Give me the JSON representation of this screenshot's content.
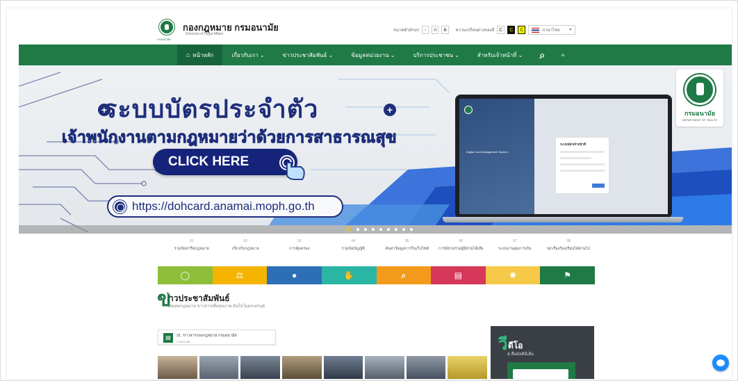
{
  "site": {
    "title": "กองกฎหมาย กรมอนามัย",
    "subtitle": "Divisions of Legal Affairs",
    "logo_caption": "กรมอนามัย"
  },
  "toolbar": {
    "font_size_label": "ขนาดตัวอักษร",
    "font_minus": "-",
    "font_small": "ก",
    "font_large": "ก",
    "contrast_label": "ความเปรียบต่างของสี",
    "contrast_normal": "C",
    "contrast_dark": "C",
    "contrast_yellow": "C",
    "language": "ภาษาไทย",
    "language_icon": "thai-flag-icon"
  },
  "nav": {
    "items": [
      {
        "label": "หน้าหลัก",
        "icon": "home-icon"
      },
      {
        "label": "เกี่ยวกับเรา ⌄"
      },
      {
        "label": "ข่าวประชาสัมพันธ์ ⌄"
      },
      {
        "label": "ข้อมูลหน่วยงาน ⌄"
      },
      {
        "label": "บริการประชาชน ⌄"
      },
      {
        "label": "สำหรับเจ้าหน้าที่ ⌄"
      }
    ],
    "search_icon": "search-icon",
    "sitemap_icon": "sitemap-icon"
  },
  "banner": {
    "title": "ระบบบัตรประจำตัว",
    "subtitle": "เจ้าพนักงานตามกฎหมายว่าด้วยการสาธารณสุข",
    "cta": "CLICK HERE",
    "url": "https://dohcard.anamai.moph.go.th",
    "laptop_screen_title": "ระบบบัตรเจ้าหน้าที่",
    "laptop_screen_left": "Digital Card Management System",
    "logo_name": "กรมอนามัย",
    "logo_en": "DEPARTMENT OF HEALTH",
    "slide_number": "01",
    "slide_count": 8,
    "active_slide": 1
  },
  "quick_links": [
    {
      "num": "01",
      "label": "รวมข้อหารือกฎหมาย"
    },
    {
      "num": "02",
      "label": "เกี่ยวกับกฎหมาย"
    },
    {
      "num": "03",
      "label": "การคุ้มครอง"
    },
    {
      "num": "04",
      "label": "รวมข้อบัญญัติ"
    },
    {
      "num": "05",
      "label": "ค้นหาข้อมูลการในเว็บไซต์"
    },
    {
      "num": "06",
      "label": "การมีส่วนร่วมผู้มีส่วนได้เสีย"
    },
    {
      "num": "07",
      "label": "ระบบงานคุมการเงิน"
    },
    {
      "num": "08",
      "label": "ทุกเรื่องร้องเรียนได้ผ่านไป"
    }
  ],
  "tiles": [
    {
      "icon": "chat-icon",
      "glyph": "◯",
      "color": "#8dbf3a"
    },
    {
      "icon": "law-scale-icon",
      "glyph": "⚖",
      "color": "#f4b400"
    },
    {
      "icon": "user-circle-icon",
      "glyph": "●",
      "color": "#2d6fb7"
    },
    {
      "icon": "hand-icon",
      "glyph": "✋",
      "color": "#2bb5a4"
    },
    {
      "icon": "search-icon",
      "glyph": "⌕",
      "color": "#f49a1a"
    },
    {
      "icon": "document-icon",
      "glyph": "▤",
      "color": "#d6385a"
    },
    {
      "icon": "gear-icon",
      "glyph": "✺",
      "color": "#f7c948"
    },
    {
      "icon": "flag-icon",
      "glyph": "⚑",
      "color": "#1f7a45"
    }
  ],
  "news": {
    "big_letter": "ข",
    "title": "่าวประชาสัมพันธ์",
    "subtitle": "อัพเดทกฎหมาย ข่าวสารเพื่อสุขภาพ ทันใจไม่ตกเทรนด์",
    "card_title": "31. ข่าวสารกองกฎหมาย กรมอนามัย",
    "card_sub": "กรมอนามัย"
  },
  "video": {
    "big_letter": "วี",
    "title": "ดีโอ",
    "subtitle": "& สื่อมัลติมีเดีย"
  },
  "colors": {
    "brand_green": "#1f7a45",
    "banner_navy": "#1e2e7a"
  }
}
